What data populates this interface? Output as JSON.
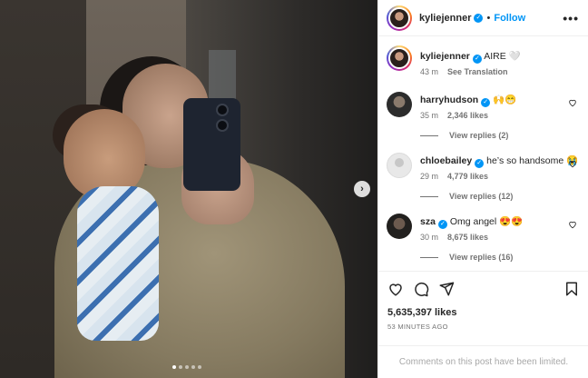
{
  "post": {
    "username": "kyliejenner",
    "follow_label": "Follow",
    "separator": "•",
    "more_label": "•••",
    "next_label": "›",
    "slides": 5,
    "active_slide": 1
  },
  "caption": {
    "username": "kyliejenner",
    "text": "AIRE 🤍",
    "time": "43 m",
    "translate_label": "See Translation"
  },
  "comments": [
    {
      "username": "harryhudson",
      "text": "🙌😁",
      "time": "35 m",
      "likes": "2,346 likes",
      "replies": "View replies (2)"
    },
    {
      "username": "chloebailey",
      "text": "he’s so handsome 😭",
      "time": "29 m",
      "likes": "4,779 likes",
      "replies": "View replies (12)"
    },
    {
      "username": "sza",
      "text": "Omg angel 😍😍",
      "time": "30 m",
      "likes": "8,675 likes",
      "replies": "View replies (16)"
    }
  ],
  "footer": {
    "likes": "5,635,397 likes",
    "posted": "53 MINUTES AGO",
    "limited_note": "Comments on this post have been limited."
  },
  "colors": {
    "accent": "#0095f6",
    "text": "#262626",
    "muted": "#737373"
  }
}
